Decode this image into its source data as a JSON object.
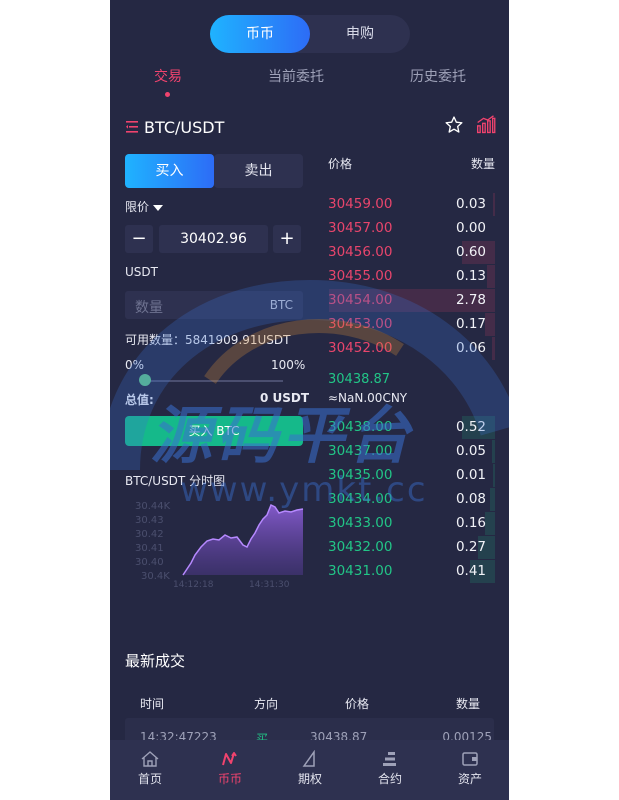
{
  "segment": {
    "active": "币币",
    "inactive": "申购"
  },
  "tabs": {
    "t1": "交易",
    "t2": "当前委托",
    "t3": "历史委托"
  },
  "pair": {
    "title": "BTC/USDT"
  },
  "trade": {
    "buy_tab": "买入",
    "sell_tab": "卖出",
    "order_type": "限价",
    "minus": "−",
    "plus": "+",
    "price": "30402.96",
    "price_unit_label": "USDT",
    "qty_placeholder": "数量",
    "qty_unit": "BTC",
    "available": "可用数量：5841909.91USDT",
    "pct_min": "0%",
    "pct_max": "100%",
    "slider_pct": 0,
    "total_label": "总值:",
    "total_value": "0 USDT",
    "buy_button": "买入 BTC",
    "chart_title": "BTC/USDT 分时图"
  },
  "mini_chart": {
    "yticks": [
      "30.44K",
      "30.43",
      "30.42",
      "30.41",
      "30.40",
      "30.4K"
    ],
    "xticks": [
      "14:12:18",
      "14:31:30"
    ]
  },
  "orderbook": {
    "price_header": "价格",
    "qty_header": "数量",
    "asks": [
      {
        "price": "30459.00",
        "qty": "0.03",
        "depth": 0.01
      },
      {
        "price": "30457.00",
        "qty": "0.00",
        "depth": 0.0
      },
      {
        "price": "30456.00",
        "qty": "0.60",
        "depth": 0.2
      },
      {
        "price": "30455.00",
        "qty": "0.13",
        "depth": 0.05
      },
      {
        "price": "30454.00",
        "qty": "2.78",
        "depth": 1.0
      },
      {
        "price": "30453.00",
        "qty": "0.17",
        "depth": 0.06
      },
      {
        "price": "30452.00",
        "qty": "0.06",
        "depth": 0.02
      }
    ],
    "last_price": "30438.87",
    "last_cny": "≈NaN.00CNY",
    "bids": [
      {
        "price": "30438.00",
        "qty": "0.52",
        "depth": 0.2
      },
      {
        "price": "30437.00",
        "qty": "0.05",
        "depth": 0.02
      },
      {
        "price": "30435.00",
        "qty": "0.01",
        "depth": 0.01
      },
      {
        "price": "30434.00",
        "qty": "0.08",
        "depth": 0.03
      },
      {
        "price": "30433.00",
        "qty": "0.16",
        "depth": 0.06
      },
      {
        "price": "30432.00",
        "qty": "0.27",
        "depth": 0.1
      },
      {
        "price": "30431.00",
        "qty": "0.41",
        "depth": 0.15
      }
    ]
  },
  "recent": {
    "title": "最新成交",
    "headers": {
      "time": "时间",
      "direction": "方向",
      "price": "价格",
      "qty": "数量"
    },
    "row": {
      "time": "14:32:47223",
      "direction": "买",
      "price": "30438.87",
      "qty": "0.00125"
    }
  },
  "nav": {
    "home": "首页",
    "coin": "币币",
    "options": "期权",
    "contract": "合约",
    "assets": "资产"
  },
  "watermark": {
    "cn": "源码平台",
    "url": "www.ymkt.cc"
  },
  "colors": {
    "bg": "#252843",
    "ask": "#e8456c",
    "bid": "#22c587",
    "accent": "#f0436e",
    "blue": "#1fb3ff"
  }
}
